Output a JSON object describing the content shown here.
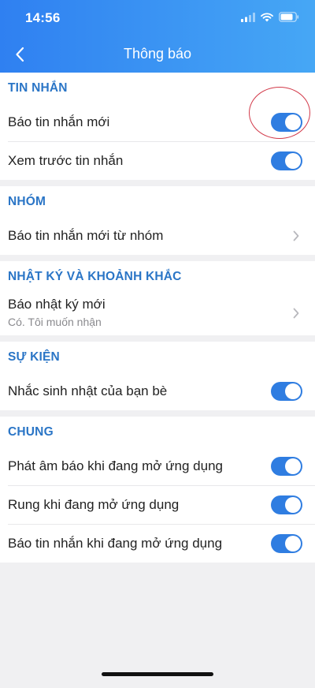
{
  "status": {
    "time": "14:56"
  },
  "nav": {
    "title": "Thông báo"
  },
  "sections": [
    {
      "header": "TIN NHẮN",
      "rows": [
        {
          "label": "Báo tin nhắn mới",
          "control": "toggle",
          "on": true
        },
        {
          "label": "Xem trước tin nhắn",
          "control": "toggle",
          "on": true
        }
      ]
    },
    {
      "header": "NHÓM",
      "rows": [
        {
          "label": "Báo tin nhắn mới từ nhóm",
          "control": "chevron"
        }
      ]
    },
    {
      "header": "NHẬT KÝ VÀ KHOẢNH KHẮC",
      "rows": [
        {
          "label": "Báo nhật ký mới",
          "sub": "Có. Tôi muốn nhận",
          "control": "chevron"
        }
      ]
    },
    {
      "header": "SỰ KIỆN",
      "rows": [
        {
          "label": "Nhắc sinh nhật của bạn bè",
          "control": "toggle",
          "on": true
        }
      ]
    },
    {
      "header": "CHUNG",
      "rows": [
        {
          "label": "Phát âm báo khi đang mở ứng dụng",
          "control": "toggle",
          "on": true
        },
        {
          "label": "Rung khi đang mở ứng dụng",
          "control": "toggle",
          "on": true
        },
        {
          "label": "Báo tin nhắn khi đang mở ứng dụng",
          "control": "toggle",
          "on": true
        }
      ]
    }
  ],
  "colors": {
    "accent": "#2f7de1",
    "section_header": "#2a75c6",
    "annotation": "#d23a4a"
  },
  "icons": {
    "back": "chevron-left-icon",
    "row_chevron": "chevron-right-icon"
  }
}
